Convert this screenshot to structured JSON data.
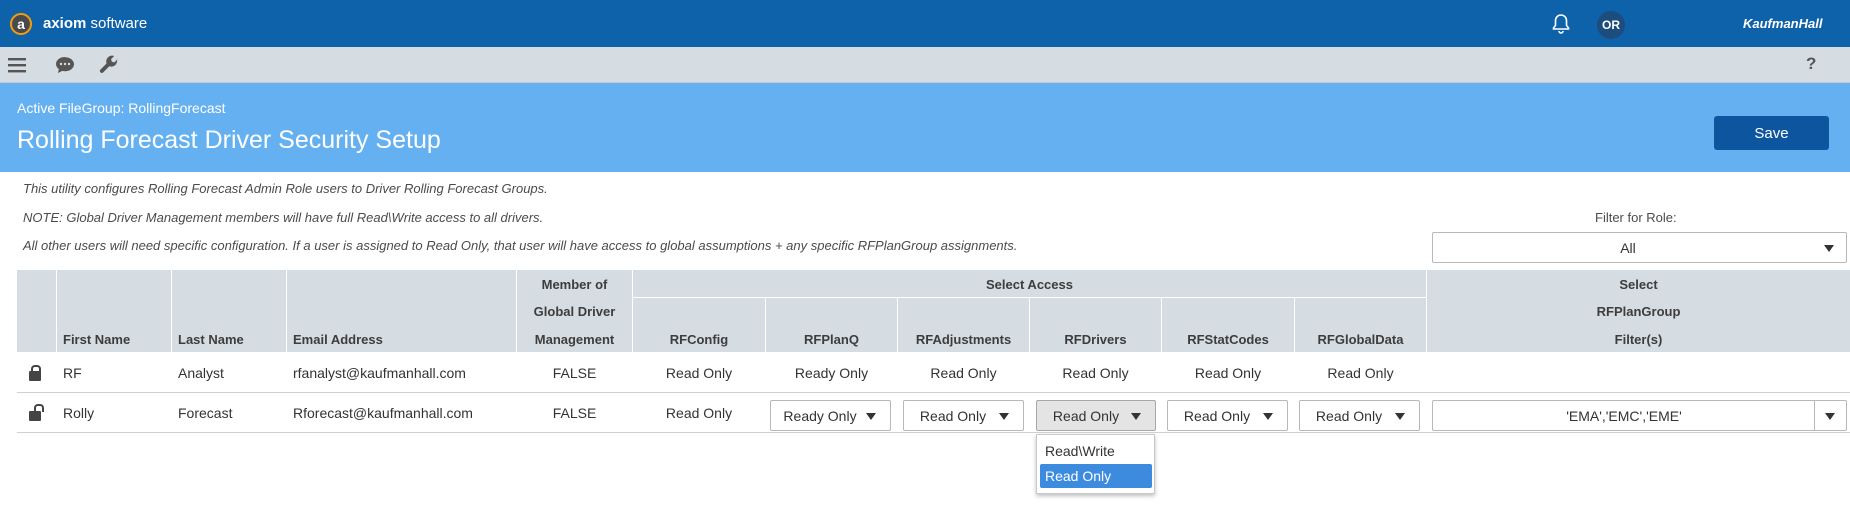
{
  "app": {
    "logo_letter": "a",
    "name_bold": "axiom",
    "name_rest": " software",
    "user_initials": "OR",
    "brand": "KaufmanHall"
  },
  "toolbar": {
    "help_label": "?"
  },
  "header": {
    "filegroup": "Active FileGroup: RollingForecast",
    "title": "Rolling Forecast Driver Security Setup",
    "save_label": "Save"
  },
  "info": {
    "line1": "This utility configures Rolling Forecast Admin Role users to Driver Rolling Forecast Groups.",
    "line2": "NOTE: Global Driver Management members will have full Read\\Write access to all drivers.",
    "line3": "All other users will need specific configuration. If a user is assigned to Read Only, that user will have access to global assumptions + any specific RFPlanGroup assignments."
  },
  "filter": {
    "label": "Filter for Role:",
    "value": "All"
  },
  "table": {
    "headers": {
      "first_name": "First Name",
      "last_name": "Last Name",
      "email": "Email Address",
      "member_1": "Member of",
      "member_2": "Global Driver",
      "member_3": "Management",
      "select_access": "Select Access",
      "rfconfig": "RFConfig",
      "rfplanq": "RFPlanQ",
      "rfadjustments": "RFAdjustments",
      "rfdrivers": "RFDrivers",
      "rfstatcodes": "RFStatCodes",
      "rfglobaldata": "RFGlobalData",
      "group_1": "Select",
      "group_2": "RFPlanGroup",
      "group_3": "Filter(s)"
    },
    "rows": [
      {
        "first": "RF",
        "last": "Analyst",
        "email": "rfanalyst@kaufmanhall.com",
        "member": "FALSE",
        "rfconfig": "Read Only",
        "rfplanq": "Ready Only",
        "rfadjustments": "Read Only",
        "rfdrivers": "Read Only",
        "rfstatcodes": "Read Only",
        "rfglobaldata": "Read Only",
        "filters": ""
      },
      {
        "first": "Rolly",
        "last": "Forecast",
        "email": "Rforecast@kaufmanhall.com",
        "member": "FALSE",
        "rfconfig": "Read Only",
        "rfplanq": "Ready Only",
        "rfadjustments": "Read Only",
        "rfdrivers": "Read Only",
        "rfstatcodes": "Read Only",
        "rfglobaldata": "Read Only",
        "filters": "'EMA','EMC','EME'"
      }
    ]
  },
  "dropdown_popup": {
    "options": [
      "Read\\Write",
      "Read Only"
    ],
    "selected": "Read Only"
  },
  "colors": {
    "topbar": "#0e62a9",
    "header": "#64b0f0",
    "save": "#0e55a0",
    "table_header": "#d5dce2",
    "selected_option": "#3d8bdf"
  }
}
